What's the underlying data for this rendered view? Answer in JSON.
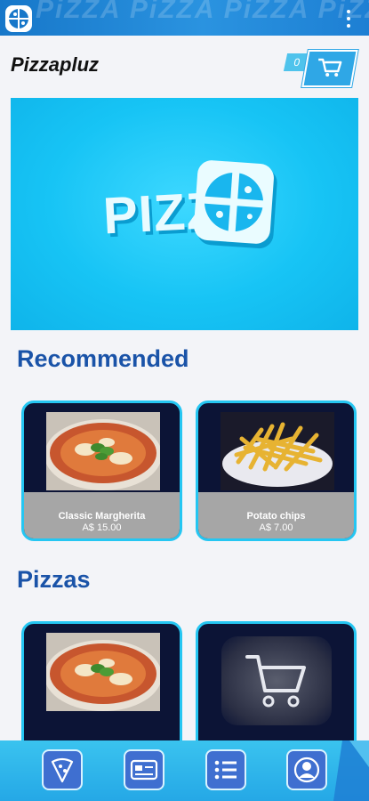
{
  "header": {
    "app_name": "Pizzapluz",
    "watermark": "PiZZA PiZZA PiZZA PiZZA"
  },
  "cart": {
    "count": "0"
  },
  "banner": {
    "text": "PIZZA"
  },
  "sections": {
    "recommended": {
      "title": "Recommended",
      "items": [
        {
          "name": "Classic Margherita",
          "price": "A$ 15.00"
        },
        {
          "name": "Potato chips",
          "price": "A$ 7.00"
        }
      ]
    },
    "pizzas": {
      "title": "Pizzas"
    }
  },
  "nav": {
    "items": [
      "pizza-icon",
      "card-icon",
      "list-icon",
      "profile-icon"
    ]
  },
  "colors": {
    "accent": "#25c6f2",
    "title": "#1a53a8",
    "card_bg": "#0c1436"
  }
}
